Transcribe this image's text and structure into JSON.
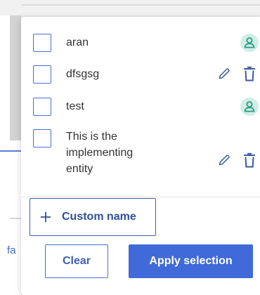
{
  "background": {
    "partial_text": "fa"
  },
  "selection_list": {
    "items": [
      {
        "label": "aran",
        "checked": false,
        "action_icons": [
          "user-icon"
        ]
      },
      {
        "label": "dfsgsg",
        "checked": false,
        "action_icons": [
          "pencil-icon",
          "trash-icon"
        ]
      },
      {
        "label": "test",
        "checked": false,
        "action_icons": [
          "user-icon"
        ]
      },
      {
        "label_lines": [
          "This is the",
          "implementing",
          "entity"
        ],
        "checked": false,
        "action_icons": [
          "pencil-icon",
          "trash-icon"
        ]
      }
    ]
  },
  "custom_name_button": {
    "label": "Custom name",
    "icon": "plus-icon"
  },
  "footer": {
    "clear_label": "Clear",
    "apply_label": "Apply selection"
  },
  "colors": {
    "accent": "#3f6ad8",
    "user_icon_bg": "#cfeee6",
    "user_icon_fg": "#2a9d7f",
    "icon_blue": "#3a5aa0"
  }
}
